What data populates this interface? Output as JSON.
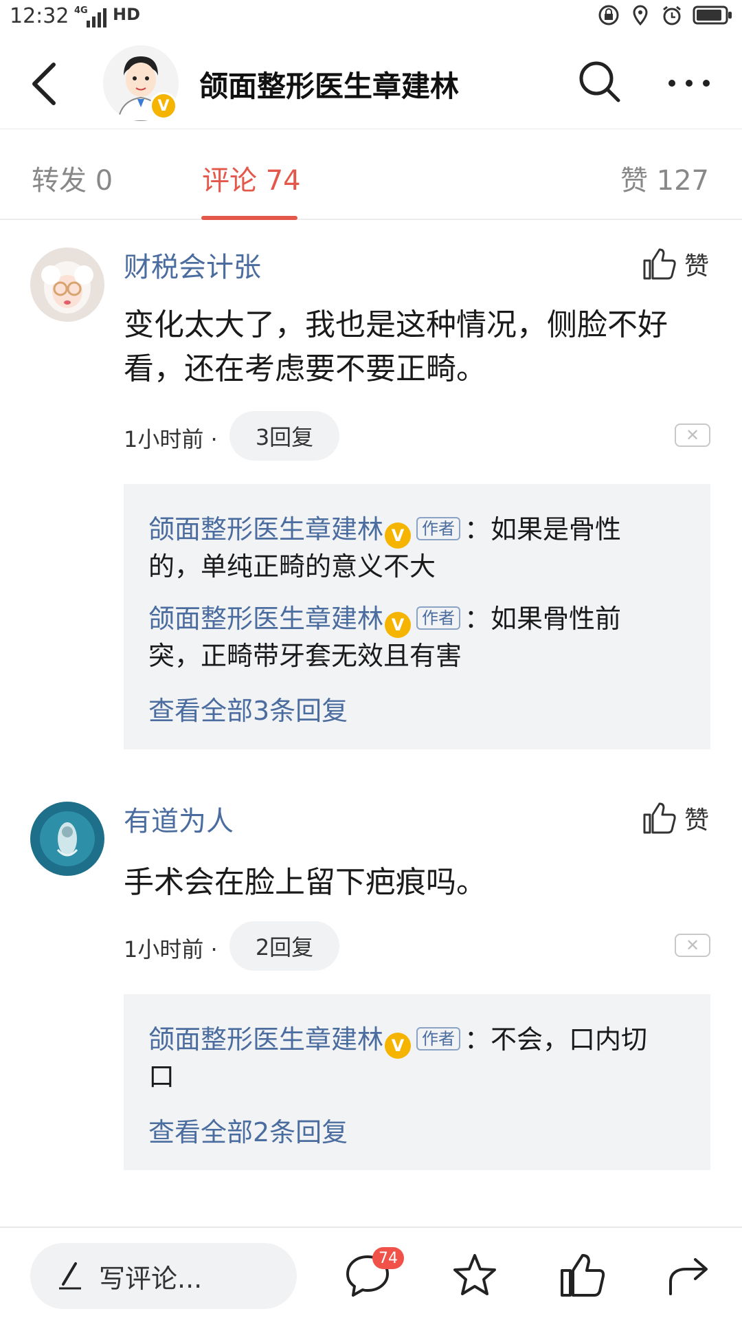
{
  "status_bar": {
    "time": "12:32",
    "network": "4G",
    "hd": "HD"
  },
  "header": {
    "title": "颌面整形医生章建林",
    "verified": "V"
  },
  "tabs": {
    "forward": "转发 0",
    "comments": "评论 74",
    "likes": "赞 127"
  },
  "comments": [
    {
      "user": "财税会计张",
      "like_label": "赞",
      "text_line1": "变化太大了，我也是这种情况，侧脸不好",
      "text_line2": "看，还在考虑要不要正畸。",
      "time": "1小时前 ·",
      "reply_count": "3回复",
      "close": "✕",
      "replies": [
        {
          "name": "颌面整形医生章建林",
          "tag": "作者",
          "text1": "：如果是骨性",
          "text2": "的，单纯正畸的意义不大"
        },
        {
          "name": "颌面整形医生章建林",
          "tag": "作者",
          "text1": "：如果骨性前",
          "text2": "突，正畸带牙套无效且有害"
        }
      ],
      "view_all": "查看全部3条回复"
    },
    {
      "user": "有道为人",
      "like_label": "赞",
      "text_line1": "手术会在脸上留下疤痕吗。",
      "time": "1小时前 ·",
      "reply_count": "2回复",
      "close": "✕",
      "replies": [
        {
          "name": "颌面整形医生章建林",
          "tag": "作者",
          "text1": "：不会，口内切",
          "text2": "口"
        }
      ],
      "view_all": "查看全部2条回复"
    }
  ],
  "bottom_bar": {
    "write_placeholder": "写评论...",
    "comment_badge": "74"
  },
  "colors": {
    "accent": "#e4574b",
    "link": "#4b6c9e",
    "verified": "#f4b400",
    "reply_bg": "#f2f3f5"
  }
}
